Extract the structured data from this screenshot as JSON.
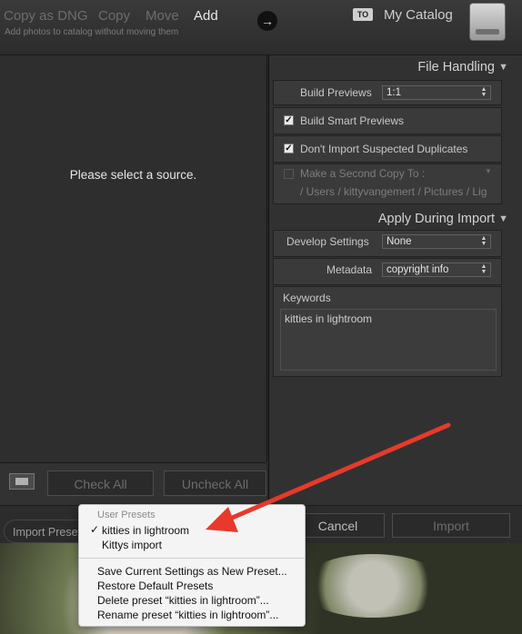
{
  "header": {
    "modes": [
      "Copy as DNG",
      "Copy",
      "Move",
      "Add"
    ],
    "active_mode": "Add",
    "subtitle": "Add photos to catalog without moving them",
    "to_badge": "TO",
    "catalog": "My Catalog",
    "icons": {
      "arrow": "right-arrow-icon",
      "drive": "hard-drive-icon"
    }
  },
  "left_pane": {
    "placeholder": "Please select a source.",
    "check_all": "Check All",
    "uncheck_all": "Uncheck All"
  },
  "file_handling": {
    "title": "File Handling",
    "build_previews_label": "Build Previews",
    "build_previews_value": "1:1",
    "smart_previews_label": "Build Smart Previews",
    "smart_previews_checked": true,
    "dont_import_label": "Don't Import Suspected Duplicates",
    "dont_import_checked": true,
    "second_copy_label": "Make a Second Copy To :",
    "second_copy_checked": false,
    "second_copy_path": "/ Users / kittyvangemert / Pictures / Lig"
  },
  "apply_during_import": {
    "title": "Apply During Import",
    "develop_label": "Develop Settings",
    "develop_value": "None",
    "metadata_label": "Metadata",
    "metadata_value": "copyright info",
    "keywords_label": "Keywords",
    "keywords_value": "kitties in lightroom"
  },
  "bottom": {
    "preset_label": "Import Preset",
    "cancel": "Cancel",
    "import": "Import"
  },
  "preset_menu": {
    "header": "User Presets",
    "items": [
      {
        "label": "kitties in lightroom",
        "checked": true
      },
      {
        "label": "Kittys import",
        "checked": false
      }
    ],
    "actions": [
      "Save Current Settings as New Preset...",
      "Restore Default Presets",
      "Delete preset “kitties in lightroom”...",
      "Rename preset “kitties in lightroom”..."
    ],
    "checkmark": "✓"
  },
  "colors": {
    "annotation_arrow": "#e8392b",
    "panel": "#313131",
    "menu_bg": "#f4f4f4"
  }
}
